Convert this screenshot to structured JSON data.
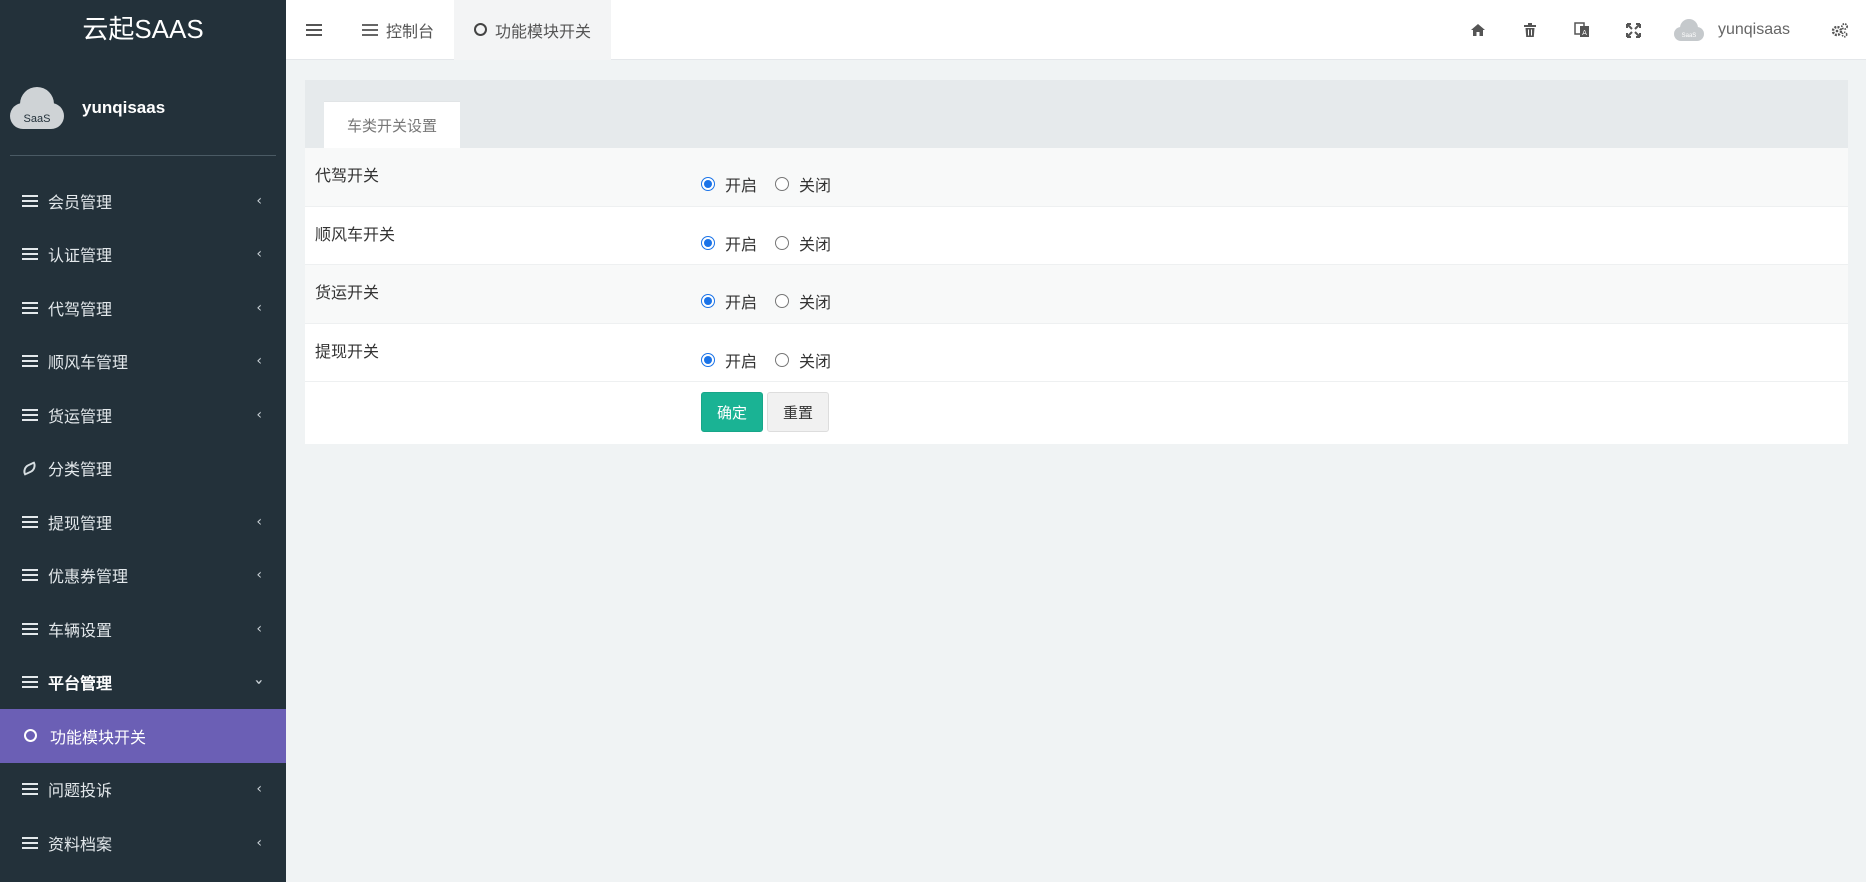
{
  "brand": "云起SAAS",
  "profile": {
    "avatar_text": "SaaS",
    "name": "yunqisaas"
  },
  "sidebar": {
    "items": [
      {
        "label": "会员管理",
        "icon": "list-icon",
        "state": "collapsed"
      },
      {
        "label": "认证管理",
        "icon": "list-icon",
        "state": "collapsed"
      },
      {
        "label": "代驾管理",
        "icon": "list-icon",
        "state": "collapsed"
      },
      {
        "label": "顺风车管理",
        "icon": "list-icon",
        "state": "collapsed"
      },
      {
        "label": "货运管理",
        "icon": "list-icon",
        "state": "collapsed"
      },
      {
        "label": "分类管理",
        "icon": "leaf-icon",
        "state": "none"
      },
      {
        "label": "提现管理",
        "icon": "list-icon",
        "state": "collapsed"
      },
      {
        "label": "优惠券管理",
        "icon": "list-icon",
        "state": "collapsed"
      },
      {
        "label": "车辆设置",
        "icon": "list-icon",
        "state": "collapsed"
      },
      {
        "label": "平台管理",
        "icon": "list-icon",
        "state": "expanded"
      },
      {
        "label": "功能模块开关",
        "icon": "circle-icon",
        "state": "active"
      },
      {
        "label": "问题投诉",
        "icon": "list-icon",
        "state": "collapsed"
      },
      {
        "label": "资料档案",
        "icon": "list-icon",
        "state": "collapsed"
      }
    ]
  },
  "topbar": {
    "tabs": [
      {
        "label": "控制台",
        "icon": "list-icon"
      },
      {
        "label": "功能模块开关",
        "icon": "circle-icon"
      }
    ],
    "user": {
      "avatar_text": "SaaS",
      "name": "yunqisaas"
    },
    "icons": [
      "home-icon",
      "trash-icon",
      "language-icon",
      "fullscreen-icon",
      "settings-icon"
    ]
  },
  "panel": {
    "tab_label": "车类开关设置",
    "rows": [
      {
        "label": "代驾开关",
        "on_label": "开启",
        "off_label": "关闭",
        "selected": "on"
      },
      {
        "label": "顺风车开关",
        "on_label": "开启",
        "off_label": "关闭",
        "selected": "on"
      },
      {
        "label": "货运开关",
        "on_label": "开启",
        "off_label": "关闭",
        "selected": "on"
      },
      {
        "label": "提现开关",
        "on_label": "开启",
        "off_label": "关闭",
        "selected": "on"
      }
    ],
    "confirm_label": "确定",
    "reset_label": "重置"
  },
  "colors": {
    "sidebar_bg": "#23313a",
    "active_item": "#6b5fb5",
    "primary_button": "#1ab394",
    "radio_checked": "#1a73e8"
  }
}
